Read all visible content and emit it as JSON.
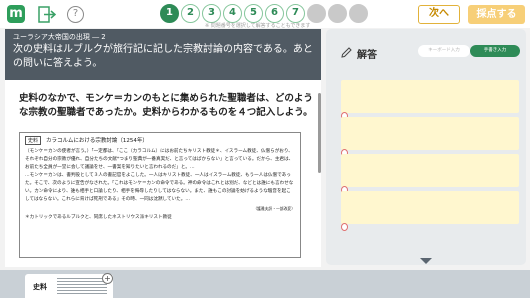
{
  "toolbar": {
    "logo_letter": "m",
    "help_label": "?",
    "question_numbers": [
      {
        "label": "1",
        "state": "current"
      },
      {
        "label": "2",
        "state": "available"
      },
      {
        "label": "3",
        "state": "available"
      },
      {
        "label": "4",
        "state": "available"
      },
      {
        "label": "5",
        "state": "available"
      },
      {
        "label": "6",
        "state": "available"
      },
      {
        "label": "7",
        "state": "available"
      },
      {
        "label": "",
        "state": "disabled"
      },
      {
        "label": "",
        "state": "disabled"
      },
      {
        "label": "",
        "state": "disabled"
      }
    ],
    "nav_note": "※ 問題番号を選択して解答することもできます",
    "next_label": "次へ",
    "grade_label": "採点する",
    "accent": "#2e8b57",
    "grade_color": "#f7cf78"
  },
  "question": {
    "title": "ユーラシア大帝国の出現 ― 2",
    "text": "次の史料はルブルクが旅行記に記した宗教討論の内容である。あとの問いに答えよう。",
    "sub_question": "史料のなかで、モンケ＝カンのもとに集められた聖職者は、どのような宗教の聖職者であったか。史料からわかるものを４つ記入しよう。"
  },
  "source": {
    "label": "史料",
    "title": "カラコルムにおける宗教討論（1254年）",
    "paragraphs": [
      "（モンケ＝カンの使者が言う。）「一定都は、『ここ（カラコルム）にはお前たちキリスト教徒＊、イスラーム教徒、仏僧らがおり、それぞれ自分の宗教が優れ、自分たちの文献*つまり聖典が一番真実だ、と言ってはばからない」と言っている。だから、主君は、お前たち全員が一堂に会して議論をせ、一書案を知りたいと言われるのだ」と。…",
      "…モンケ＝カンは、書判役として３人の書記官をよこした。一人はキリスト教徒、一人はイスラーム教徒、もう一人は仏僧であった。そこで、次のように宣告がなされた。「これはモンケ＝カンの命令である。神の命令はこれとは別だ、などとは誰にも言わせない。カン命令により、誰も相手と口論したり、相手を侮辱したりしてはならない。また、誰もこの討論を妨げるような騒音を起こしてはならない。これらに背けば死刑である」その時、一同は沈黙していた。…"
    ],
    "citation": "（護雅夫訳・一部改変）",
    "note": "＊カトリックであるルブルクと、同席したネストリウス派キリスト教徒"
  },
  "answer_panel": {
    "title": "解答",
    "keyboard_label": "キーボード入力",
    "handwriting_label": "手書き入力",
    "slot_count": 4,
    "slot_color": "#fff7cf"
  },
  "tray": {
    "doc_label": "史料"
  }
}
